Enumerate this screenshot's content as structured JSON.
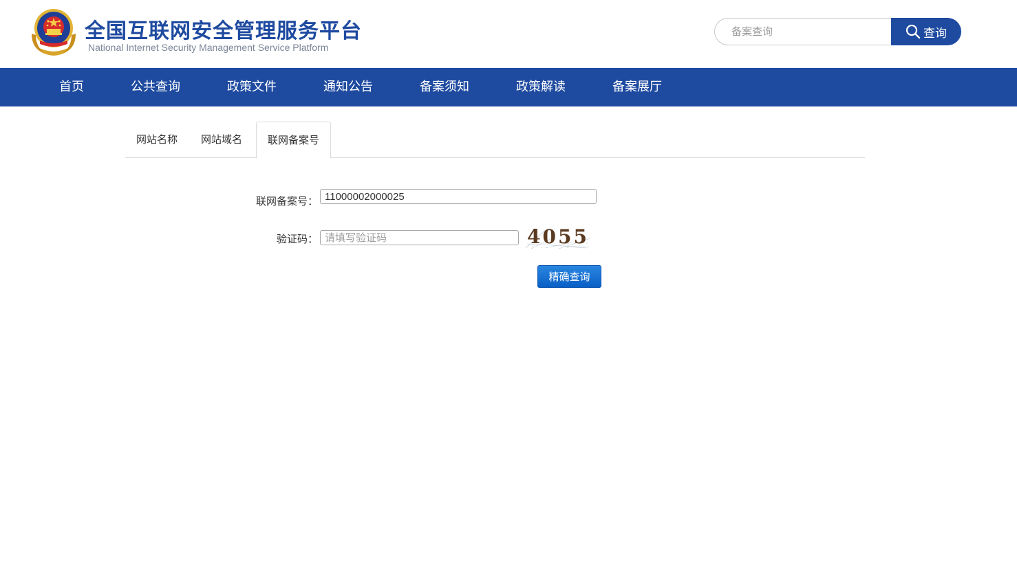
{
  "header": {
    "title": "全国互联网安全管理服务平台",
    "subtitle": "National Internet Security Management Service Platform",
    "search_placeholder": "备案查询",
    "search_button": "查询"
  },
  "nav": {
    "items": [
      {
        "label": "首页"
      },
      {
        "label": "公共查询"
      },
      {
        "label": "政策文件"
      },
      {
        "label": "通知公告"
      },
      {
        "label": "备案须知"
      },
      {
        "label": "政策解读"
      },
      {
        "label": "备案展厅"
      }
    ]
  },
  "tabs": {
    "items": [
      {
        "label": "网站名称"
      },
      {
        "label": "网站域名"
      },
      {
        "label": "联网备案号"
      }
    ],
    "active": "联网备案号"
  },
  "form": {
    "record_label": "联网备案号：",
    "record_value": "11000002000025",
    "captcha_label": "验证码：",
    "captcha_placeholder": "请填写验证码",
    "captcha_text": "4055",
    "submit_label": "精确查询"
  },
  "colors": {
    "primary": "#1e4aa0",
    "button": "#0a5fc6"
  }
}
